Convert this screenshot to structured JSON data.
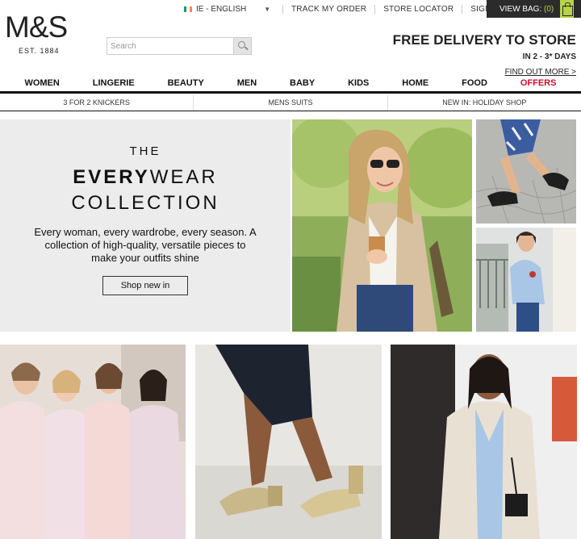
{
  "logo": {
    "main": "M&S",
    "sub": "EST. 1884"
  },
  "topbar": {
    "language": "IE - ENGLISH",
    "links": [
      "TRACK MY ORDER",
      "STORE LOCATOR",
      "SIGN IN"
    ],
    "bag_label": "VIEW BAG:",
    "bag_count": "(0)"
  },
  "search": {
    "placeholder": "Search"
  },
  "promo": {
    "title": "FREE DELIVERY TO STORE",
    "subtitle": "IN 2 - 3* DAYS",
    "link": "FIND OUT MORE >"
  },
  "nav": {
    "items": [
      "WOMEN",
      "LINGERIE",
      "BEAUTY",
      "MEN",
      "BABY",
      "KIDS",
      "HOME",
      "FOOD"
    ],
    "offers": "OFFERS"
  },
  "subnav": [
    "3 FOR 2 KNICKERS",
    "MENS SUITS",
    "NEW IN: HOLIDAY SHOP"
  ],
  "hero": {
    "line1": "THE",
    "line2_bold": "EVERY",
    "line2_rest": "WEAR",
    "line3": "COLLECTION",
    "description": "Every woman, every wardrobe, every season. A collection of high-quality, versatile pieces to make your outfits shine",
    "button": "Shop new in"
  },
  "colors": {
    "accent": "#b8d34a",
    "offers": "#c8102e",
    "dark": "#2b2b2b",
    "hero_bg": "#ececec"
  }
}
